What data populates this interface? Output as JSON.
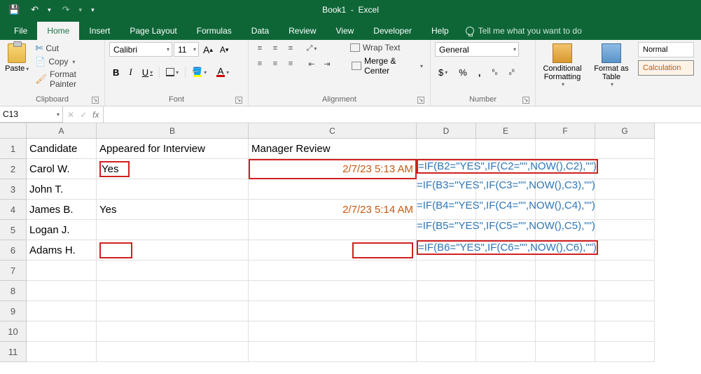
{
  "titlebar": {
    "document": "Book1",
    "app": "Excel"
  },
  "qat": {
    "save": "💾",
    "undo": "↶",
    "redo": "↷"
  },
  "tabs": {
    "file": "File",
    "home": "Home",
    "insert": "Insert",
    "page_layout": "Page Layout",
    "formulas": "Formulas",
    "data": "Data",
    "review": "Review",
    "view": "View",
    "developer": "Developer",
    "help": "Help",
    "tellme": "Tell me what you want to do"
  },
  "ribbon": {
    "clipboard": {
      "label": "Clipboard",
      "paste": "Paste",
      "cut": "Cut",
      "copy": "Copy",
      "format_painter": "Format Painter"
    },
    "font": {
      "label": "Font",
      "name": "Calibri",
      "size": "11",
      "bold": "B",
      "italic": "I",
      "underline": "U",
      "font_letter": "A",
      "fill_letter": "A"
    },
    "alignment": {
      "label": "Alignment",
      "wrap": "Wrap Text",
      "merge": "Merge & Center"
    },
    "number": {
      "label": "Number",
      "format": "General",
      "currency": "$",
      "percent": "%",
      "comma": ",",
      "inc": ".0→.00",
      "dec": ".00→.0"
    },
    "styles": {
      "conditional": "Conditional Formatting",
      "table": "Format as Table",
      "normal": "Normal",
      "calculation": "Calculation"
    }
  },
  "namebox": "C13",
  "fx_label": "fx",
  "columns": [
    "A",
    "B",
    "C",
    "D",
    "E",
    "F",
    "G"
  ],
  "rows": [
    "1",
    "2",
    "3",
    "4",
    "5",
    "6",
    "7",
    "8",
    "9",
    "10",
    "11"
  ],
  "sheet": {
    "headers": {
      "a1": "Candidate",
      "b1": "Appeared for Interview",
      "c1": "Manager Review"
    },
    "data": [
      {
        "a": "Carol W.",
        "b": "Yes",
        "c": "2/7/23 5:13 AM",
        "d": "=IF(B2=\"YES\",IF(C2=\"\",NOW(),C2),\"\")"
      },
      {
        "a": "John T.",
        "b": "",
        "c": "",
        "d": "=IF(B3=\"YES\",IF(C3=\"\",NOW(),C3),\"\")"
      },
      {
        "a": "James B.",
        "b": "Yes",
        "c": "2/7/23 5:14 AM",
        "d": "=IF(B4=\"YES\",IF(C4=\"\",NOW(),C4),\"\")"
      },
      {
        "a": "Logan J.",
        "b": "",
        "c": "",
        "d": "=IF(B5=\"YES\",IF(C5=\"\",NOW(),C5),\"\")"
      },
      {
        "a": "Adams H.",
        "b": "",
        "c": "",
        "d": "=IF(B6=\"YES\",IF(C6=\"\",NOW(),C6),\"\")"
      }
    ]
  }
}
